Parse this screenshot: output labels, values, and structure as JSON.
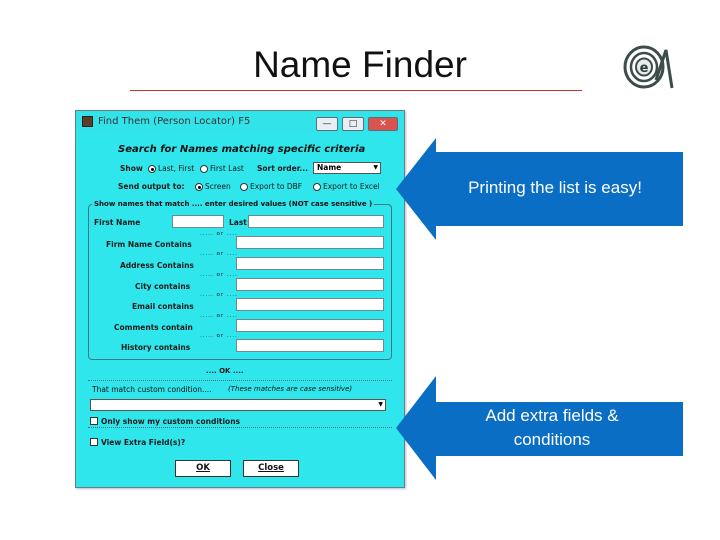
{
  "slide": {
    "title": "Name Finder"
  },
  "colors": {
    "dialog_bg": "#2fe6ec",
    "callout_blue": "#0a6ec5",
    "title_rule": "#c0392b"
  },
  "logo": {
    "icon": "e-logo-icon"
  },
  "dialog": {
    "title": "Find Them (Person Locator) F5",
    "controls": {
      "minimize": "—",
      "maximize": "□",
      "close": "✕"
    },
    "heading": "Search for Names matching specific criteria",
    "show_label": "Show",
    "show_options": [
      "Last, First",
      "First Last"
    ],
    "show_selected": 0,
    "sort_label": "Sort order...",
    "sort_value": "Name",
    "output_label": "Send output to:",
    "output_options": [
      "Screen",
      "Export to DBF",
      "Export to Excel"
    ],
    "output_selected": 0,
    "group1_caption": "Show names that match .... enter desired values  (NOT case sensitive )",
    "first_name_label": "First Name",
    "last_label": "Last",
    "or_text": "..... or ....",
    "fields": [
      "Firm Name Contains",
      "Address Contains",
      "City contains",
      "Email contains",
      "Comments contain",
      "History contains"
    ],
    "ok_text": ".... OK ....",
    "group2_caption": "That match custom condition....",
    "group2_note": "(These matches are case sensitive)",
    "only_custom_label": "Only show my custom conditions",
    "view_extra_label": "View Extra Field(s)?",
    "ok_button": "OK",
    "close_button": "Close"
  },
  "callouts": [
    {
      "text": "Printing the list is easy!"
    },
    {
      "text": "Add extra fields & conditions"
    }
  ]
}
